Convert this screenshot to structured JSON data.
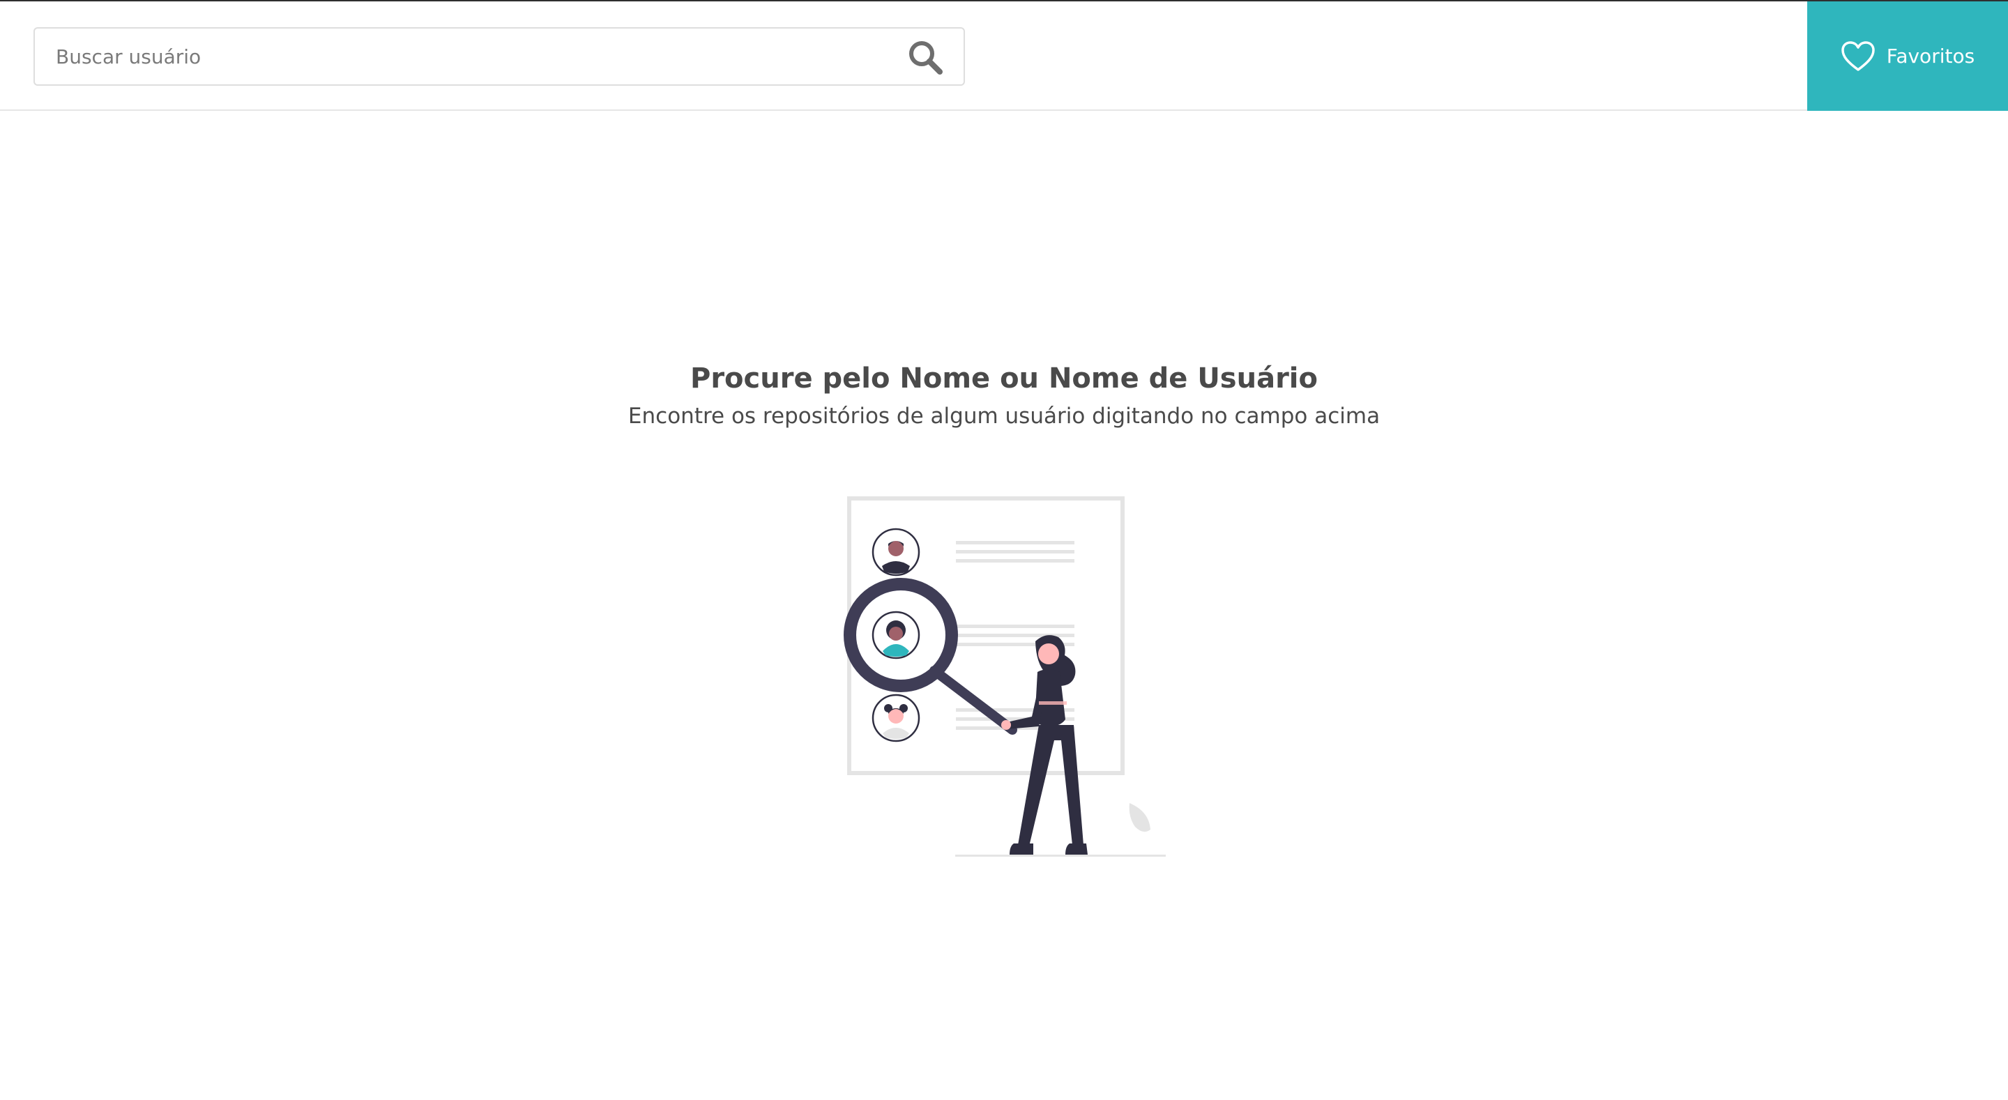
{
  "header": {
    "search": {
      "placeholder": "Buscar usuário",
      "value": "",
      "icon": "search-icon"
    },
    "favorites": {
      "label": "Favoritos",
      "icon": "heart-icon",
      "background_color": "#2fb6bd"
    }
  },
  "empty_state": {
    "title": "Procure pelo Nome ou Nome de Usuário",
    "subtitle": "Encontre os repositórios de algum usuário digitando no campo acima",
    "illustration": "people-search-illustration"
  },
  "colors": {
    "accent": "#2fb6bd",
    "text": "#4a4a4a",
    "figure_dark": "#2f2e41",
    "skin": "#ffb8b8"
  }
}
